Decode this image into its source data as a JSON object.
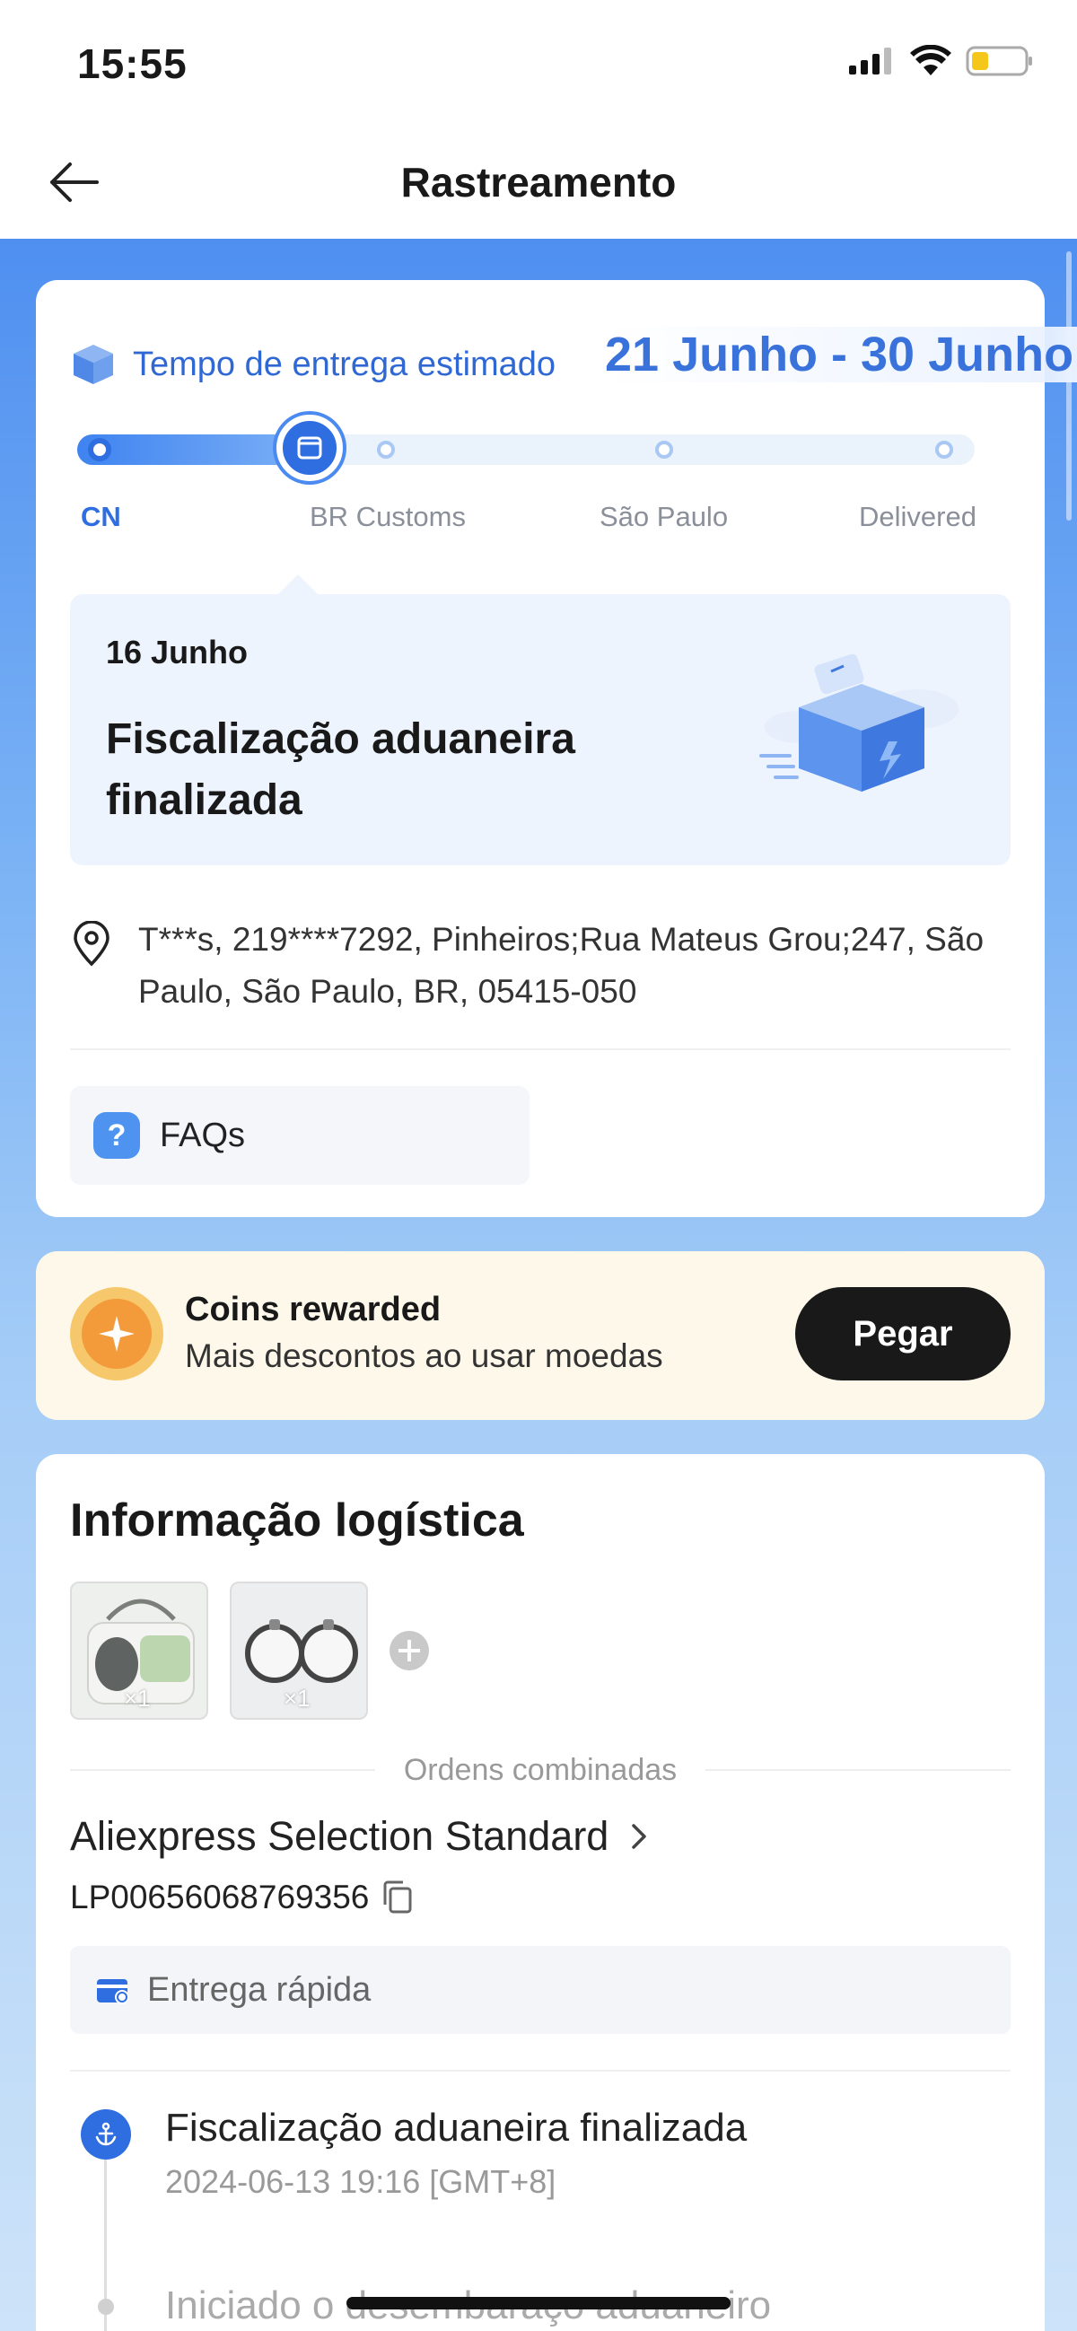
{
  "status_bar": {
    "time": "15:55"
  },
  "header": {
    "title": "Rastreamento"
  },
  "delivery": {
    "estimate_label": "Tempo de entrega estimado",
    "estimate_dates": "21 Junho - 30 Junho",
    "stages": [
      "CN",
      "BR Customs",
      "São Paulo",
      "Delivered"
    ],
    "current_stage_index": 0,
    "status_date": "16 Junho",
    "status_title": "Fiscalização aduaneira finalizada",
    "address": "T***s,  219****7292,  Pinheiros;Rua Mateus Grou;247,  São Paulo,  São Paulo,  BR,  05415-050",
    "faq_label": "FAQs"
  },
  "coins": {
    "title": "Coins rewarded",
    "subtitle": "Mais descontos ao usar moedas",
    "button_label": "Pegar"
  },
  "logistics": {
    "title": "Informação logística",
    "items": [
      {
        "qty": "×1",
        "icon": "bag-thumbnail"
      },
      {
        "qty": "×1",
        "icon": "tracker-thumbnail"
      }
    ],
    "combined_label": "Ordens combinadas",
    "carrier": "Aliexpress Selection Standard",
    "tracking_number": "LP00656068769356",
    "fast_delivery_label": "Entrega rápida",
    "timeline": [
      {
        "title": "Fiscalização aduaneira finalizada",
        "time": "2024-06-13 19:16 [GMT+8]"
      },
      {
        "title": "Iniciado o desembaraço aduaneiro",
        "time": ""
      }
    ]
  },
  "colors": {
    "accent": "#2f6ee0",
    "coin_bg": "#fdf8ea",
    "button_dark": "#191919"
  }
}
